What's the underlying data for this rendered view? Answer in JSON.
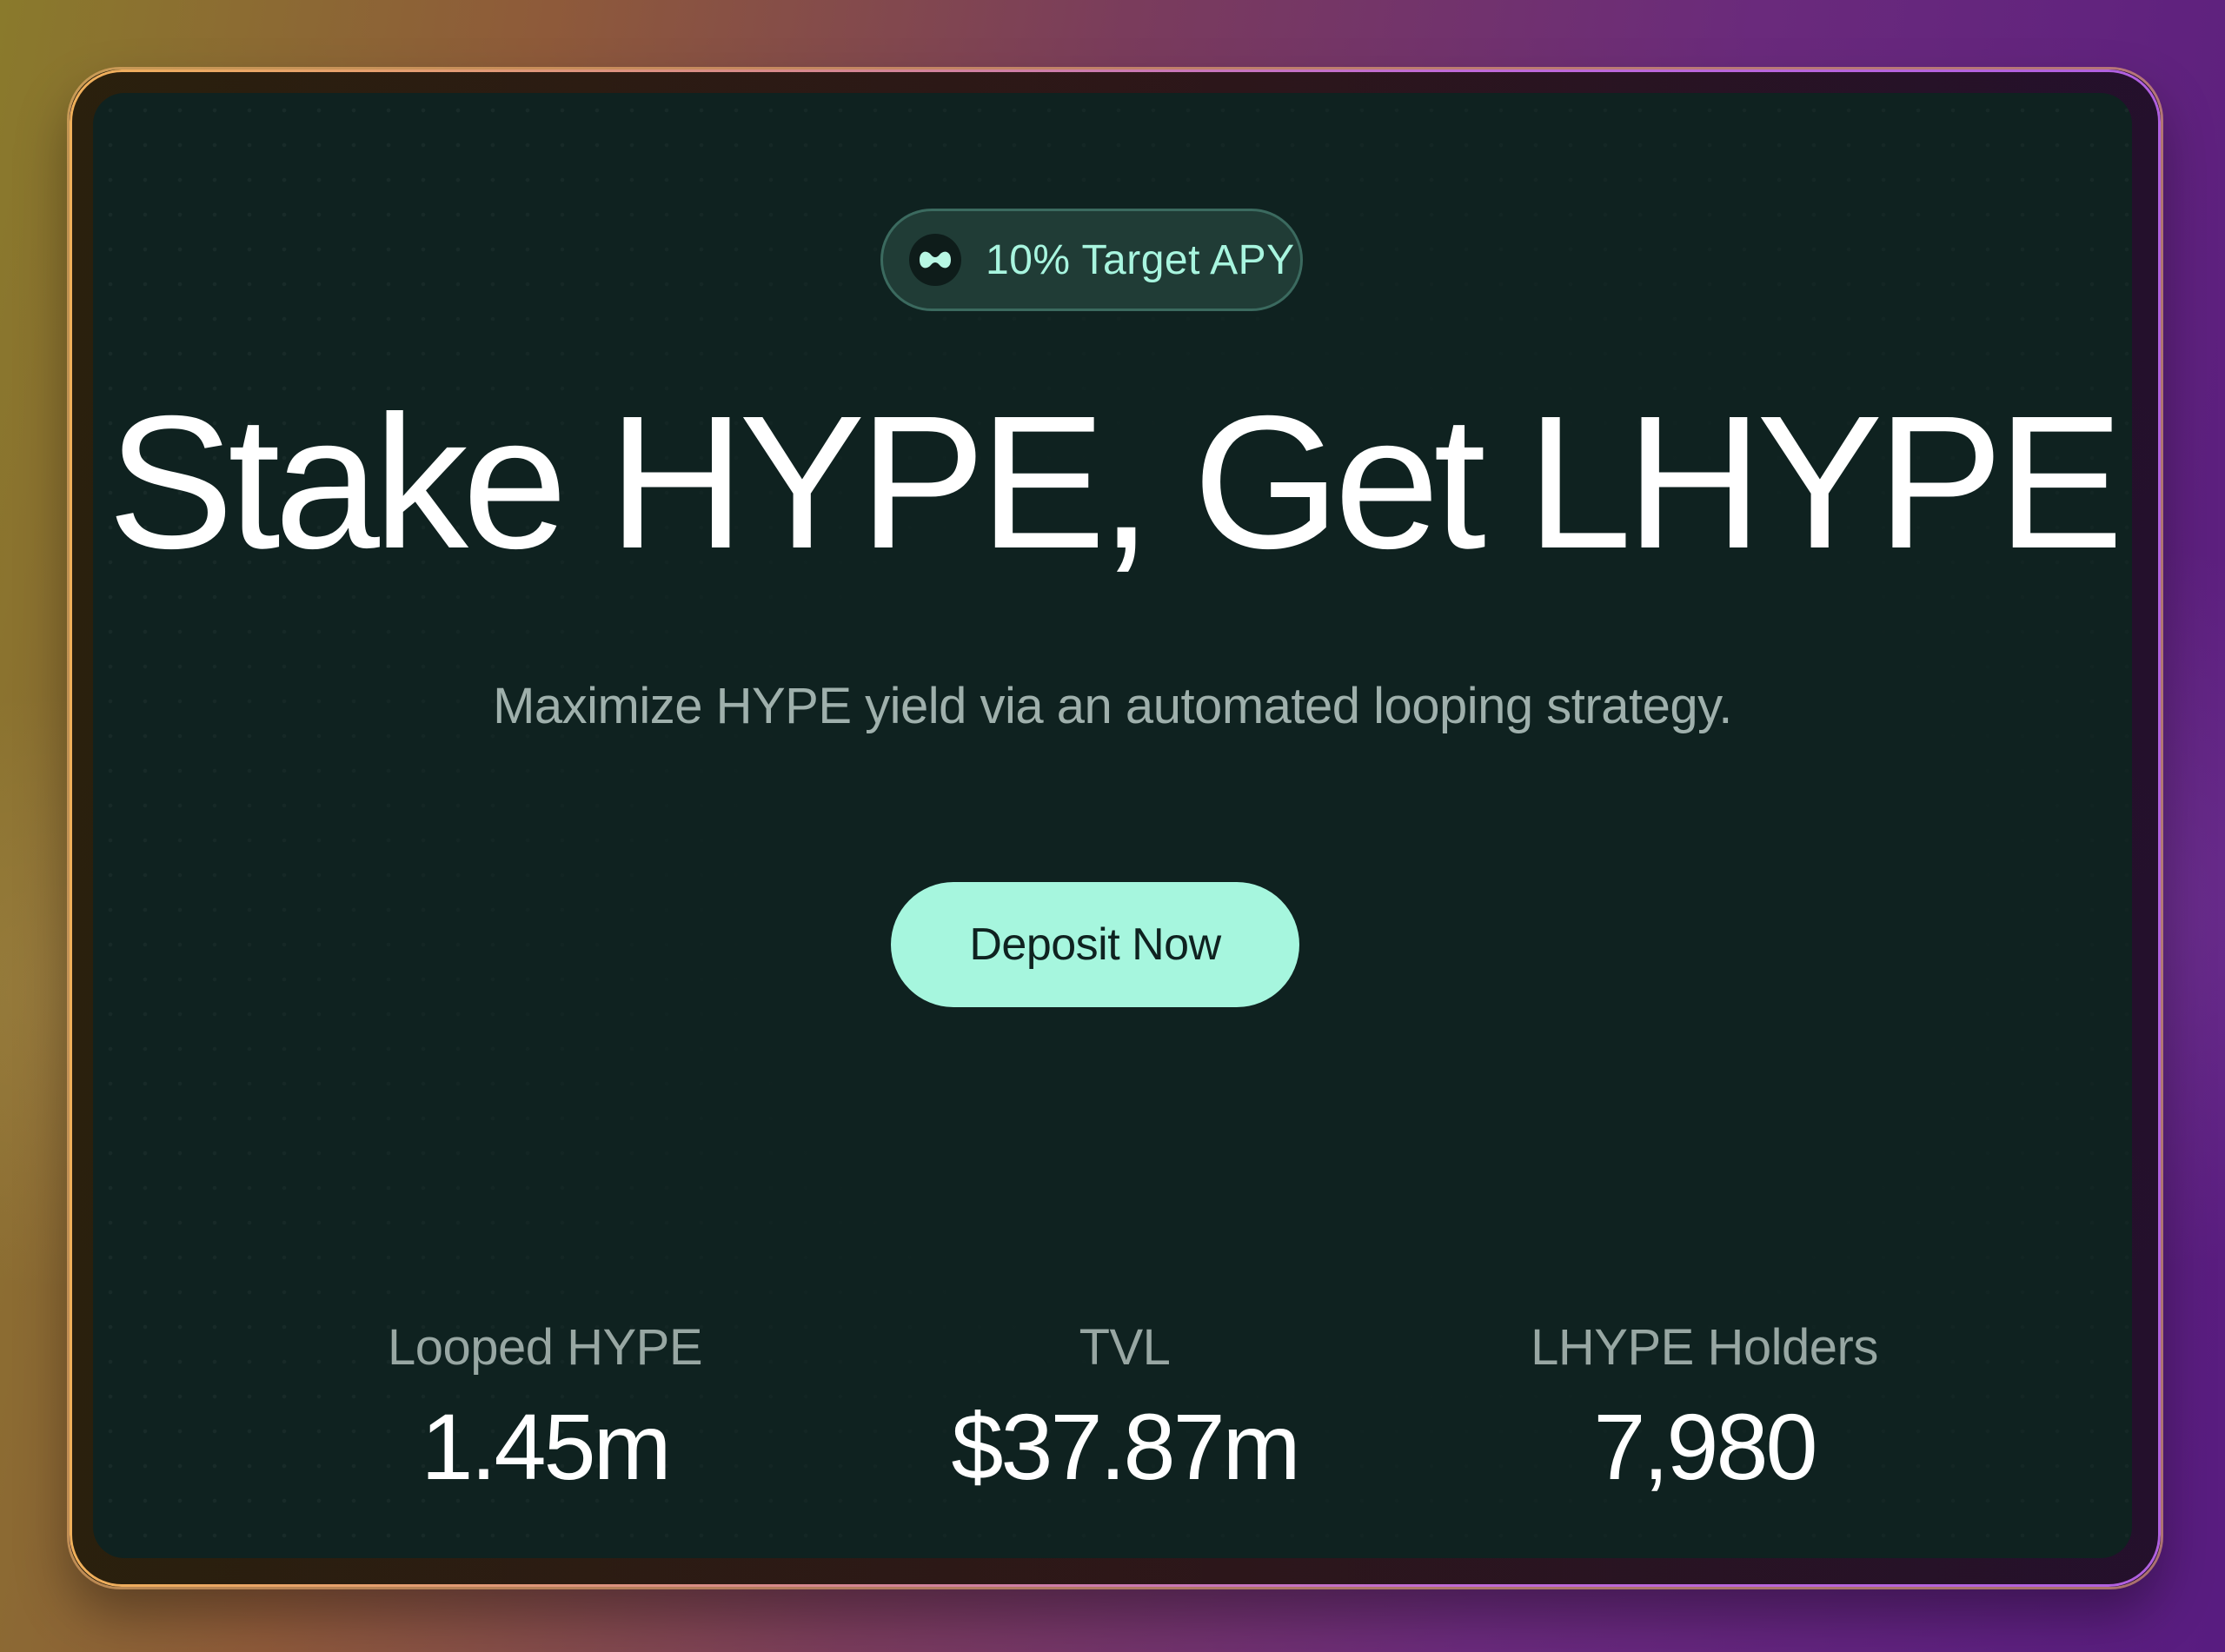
{
  "badge": {
    "icon": "logo-icon",
    "text": "10% Target APY"
  },
  "hero": {
    "title": "Stake HYPE, Get LHYPE",
    "subtitle": "Maximize HYPE yield via an automated looping strategy."
  },
  "cta": {
    "label": "Deposit Now"
  },
  "stats": [
    {
      "label": "Looped HYPE",
      "value": "1.45m"
    },
    {
      "label": "TVL",
      "value": "$37.87m"
    },
    {
      "label": "LHYPE Holders",
      "value": "7,980"
    }
  ],
  "colors": {
    "accent": "#a6f6de",
    "card_background": "#0f2220",
    "badge_text": "#a8f5df"
  }
}
